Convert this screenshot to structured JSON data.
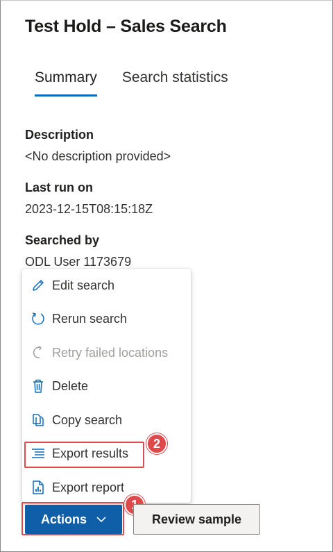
{
  "panel": {
    "title": "Test Hold – Sales Search"
  },
  "tabs": [
    {
      "label": "Summary",
      "active": true
    },
    {
      "label": "Search statistics",
      "active": false
    }
  ],
  "details": {
    "description_label": "Description",
    "description_value": "<No description provided>",
    "last_run_label": "Last run on",
    "last_run_value": "2023-12-15T08:15:18Z",
    "searched_by_label": "Searched by",
    "searched_by_value": "ODL User 1173679"
  },
  "actions_menu": {
    "items": [
      {
        "label": "Edit search",
        "icon": "pencil-icon",
        "enabled": true
      },
      {
        "label": "Rerun search",
        "icon": "refresh-icon",
        "enabled": true
      },
      {
        "label": "Retry failed locations",
        "icon": "retry-icon",
        "enabled": false
      },
      {
        "label": "Delete",
        "icon": "trash-icon",
        "enabled": true
      },
      {
        "label": "Copy search",
        "icon": "copy-icon",
        "enabled": true
      },
      {
        "label": "Export results",
        "icon": "list-icon",
        "enabled": true
      },
      {
        "label": "Export report",
        "icon": "report-icon",
        "enabled": true
      }
    ]
  },
  "footer": {
    "actions_label": "Actions",
    "review_label": "Review sample"
  },
  "annotations": {
    "step1": "1",
    "step2": "2",
    "color": "#e0494b"
  },
  "colors": {
    "accent": "#0f6cbd",
    "primary_button": "#0f5ea8"
  }
}
